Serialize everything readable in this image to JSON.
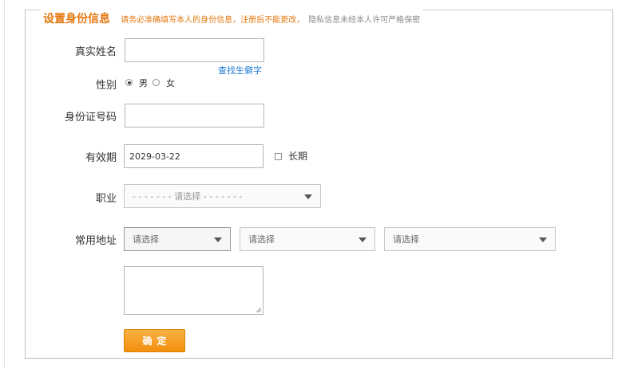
{
  "section": {
    "title": "设置身份信息",
    "hint_warning": "请务必准确填写本人的身份信息，注册后不能更改，",
    "hint_privacy": "隐私信息未经本人许可严格保密"
  },
  "form": {
    "real_name_label": "真实姓名",
    "real_name_value": "",
    "rare_char_link": "查找生僻字",
    "gender_label": "性别",
    "gender_male": "男",
    "gender_female": "女",
    "gender_selected": "男",
    "id_number_label": "身份证号码",
    "id_number_value": "",
    "validity_label": "有效期",
    "validity_value": "2029-03-22",
    "long_term_label": "长期",
    "occupation_label": "职业",
    "occupation_placeholder": "- - - - - - - 请选择 - - - - - - -",
    "address_label": "常用地址",
    "address_select_1": "请选择",
    "address_select_2": "请选择",
    "address_select_3": "请选择",
    "address_detail_value": "",
    "confirm_button": "确定"
  },
  "colors": {
    "accent_orange": "#e4770f",
    "link_blue": "#1d7ad6",
    "button_orange": "#f4a023"
  }
}
